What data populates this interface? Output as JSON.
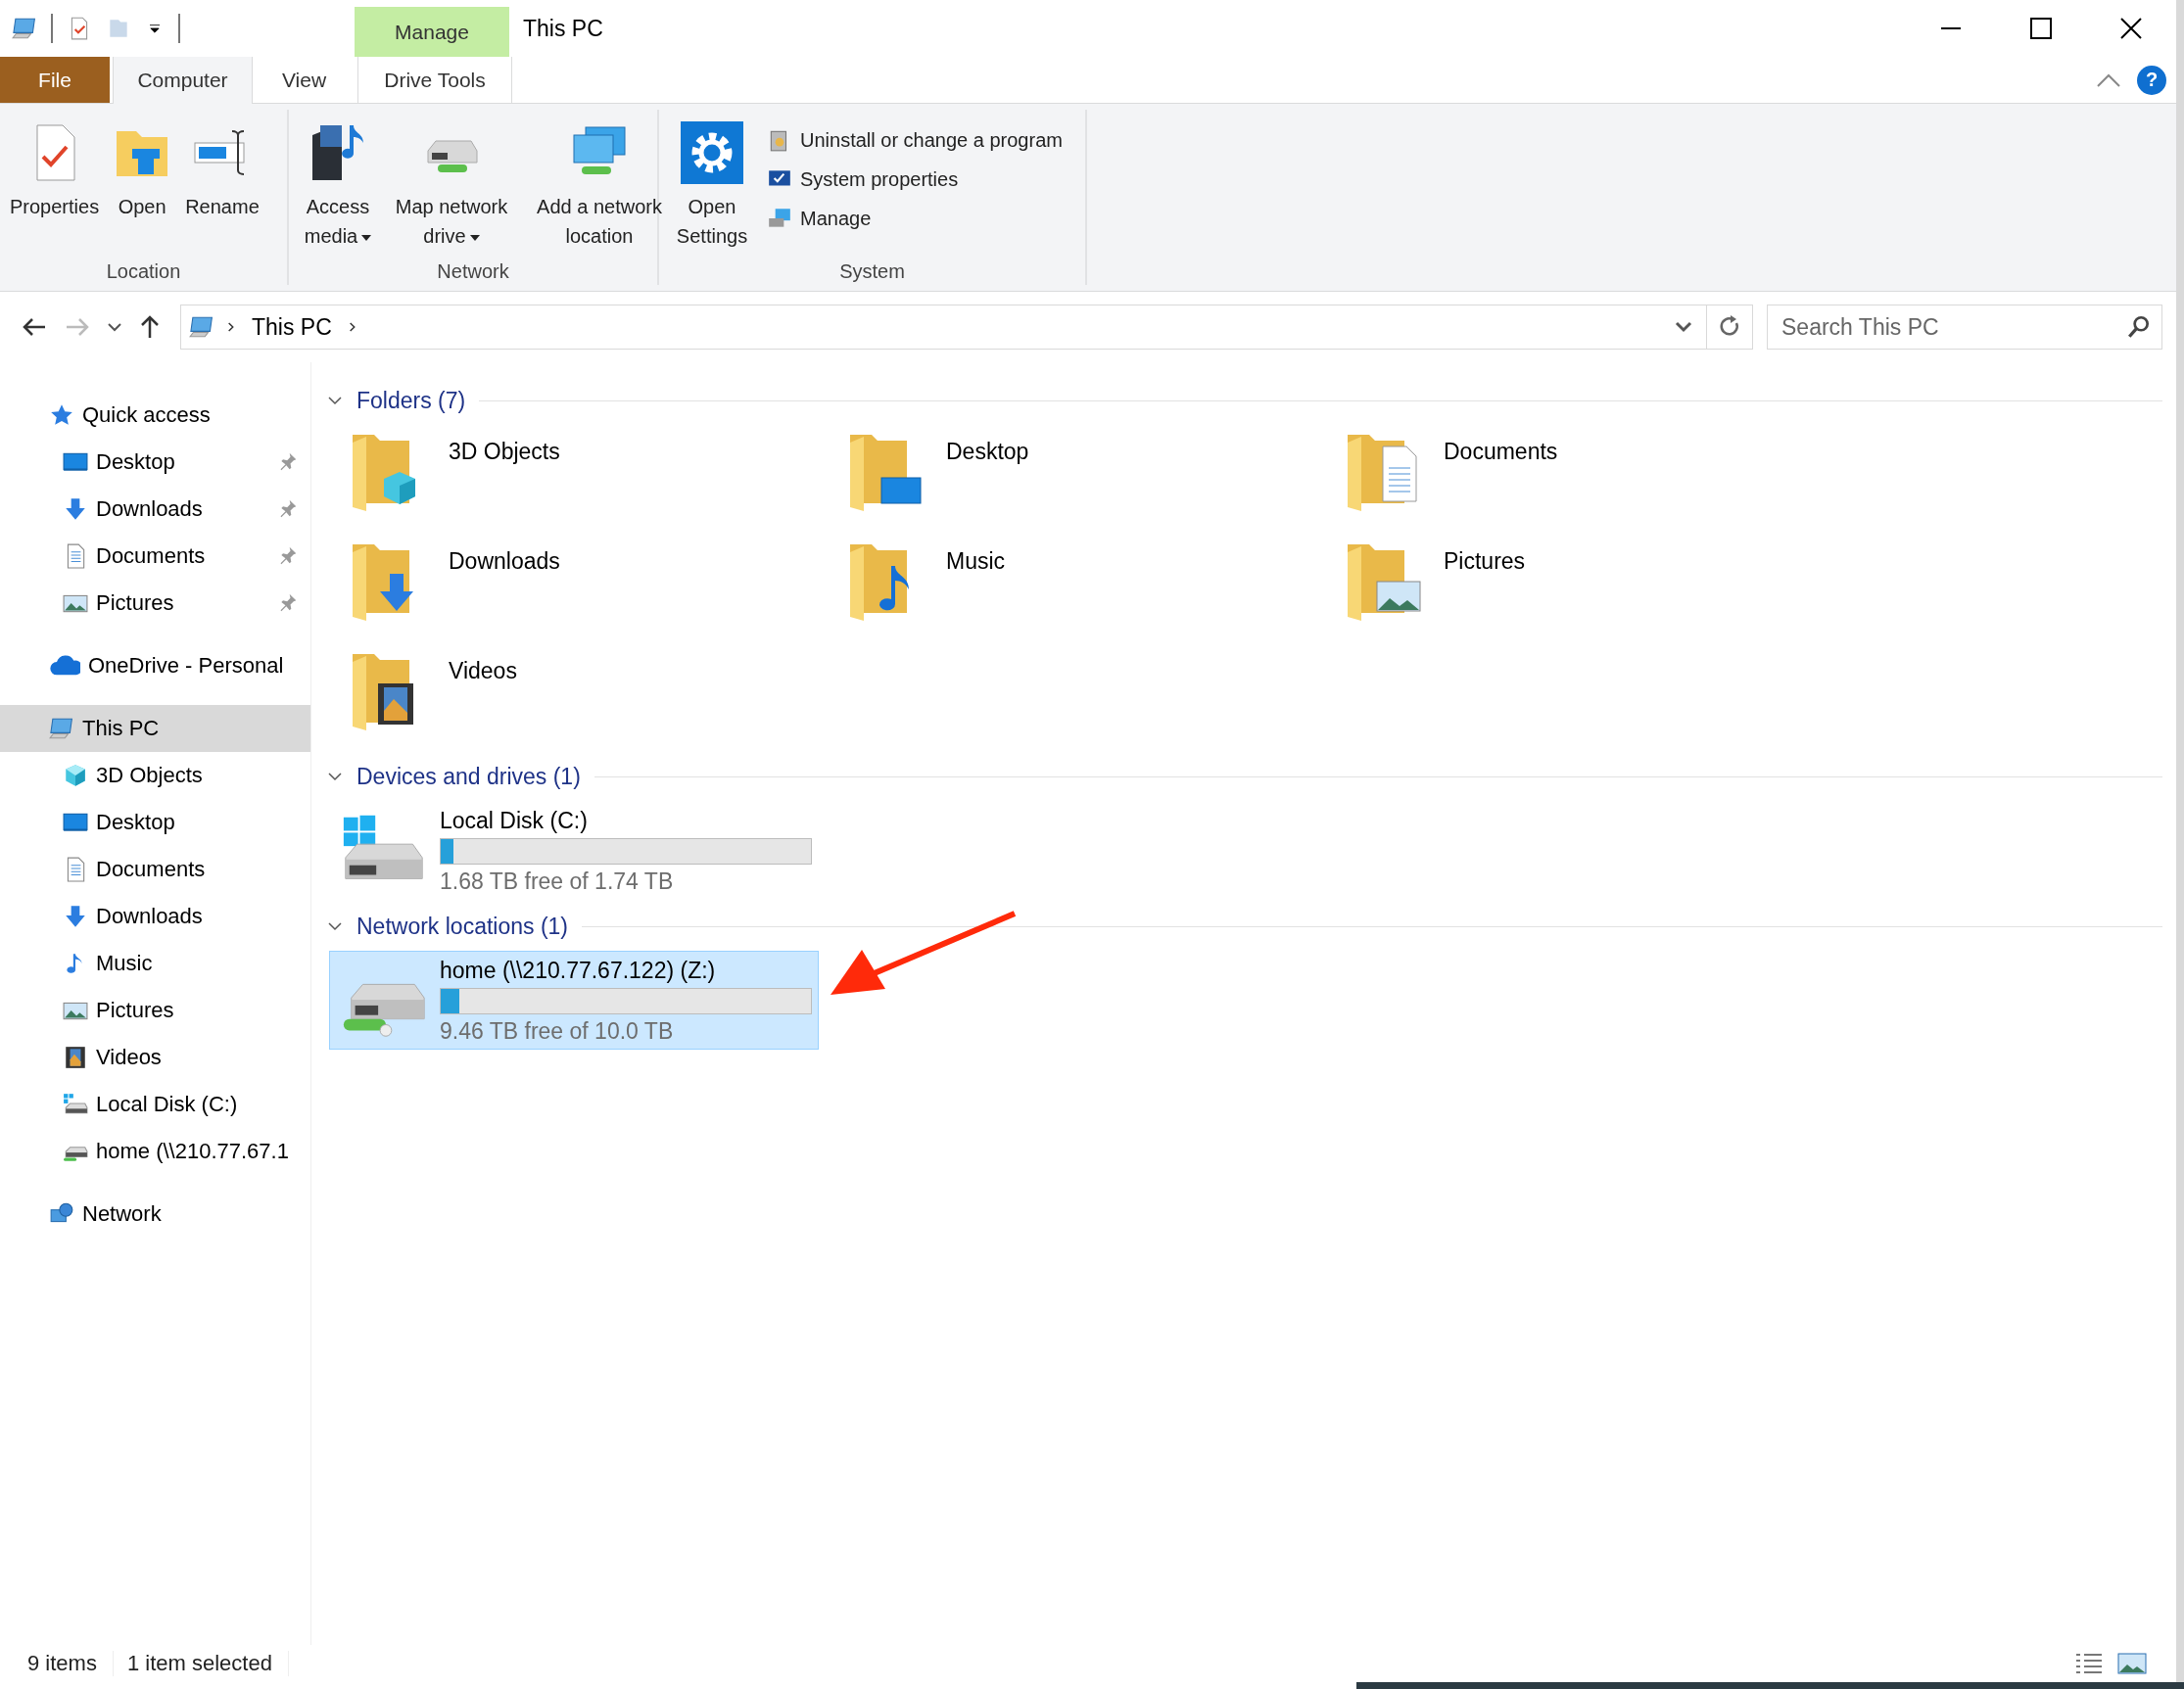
{
  "window": {
    "title": "This PC",
    "context_tab": "Manage",
    "help": "?"
  },
  "ribbon_tabs": [
    {
      "label": "File",
      "kind": "file",
      "selected": false
    },
    {
      "label": "Computer",
      "kind": "plain",
      "selected": true
    },
    {
      "label": "View",
      "kind": "plain",
      "selected": false
    },
    {
      "label": "Drive Tools",
      "kind": "contextual",
      "selected": false
    }
  ],
  "ribbon_groups": [
    {
      "label": "Location",
      "commands": [
        {
          "label": "Properties",
          "kind": "properties",
          "dropdown": false
        },
        {
          "label": "Open",
          "kind": "open",
          "dropdown": false
        },
        {
          "label": "Rename",
          "kind": "rename",
          "dropdown": false
        }
      ]
    },
    {
      "label": "Network",
      "commands": [
        {
          "label": "Access media",
          "kind": "media",
          "dropdown": true
        },
        {
          "label": "Map network drive",
          "kind": "mapdrive",
          "dropdown": true
        },
        {
          "label": "Add a network location",
          "kind": "addlocation",
          "dropdown": false
        }
      ]
    },
    {
      "label": "System",
      "commands": [
        {
          "label": "Open Settings",
          "kind": "settings",
          "dropdown": false
        }
      ],
      "small_commands": [
        {
          "label": "Uninstall or change a program",
          "kind": "uninstall"
        },
        {
          "label": "System properties",
          "kind": "sysprops"
        },
        {
          "label": "Manage",
          "kind": "manage"
        }
      ]
    }
  ],
  "address": {
    "path": [
      "This PC"
    ],
    "search_placeholder": "Search This PC"
  },
  "sidebar": {
    "items": [
      {
        "label": "Quick access",
        "kind": "star",
        "selected": false,
        "children": [
          {
            "label": "Desktop",
            "kind": "desktop",
            "selected": false,
            "pinned": true
          },
          {
            "label": "Downloads",
            "kind": "downloads",
            "selected": false,
            "pinned": true
          },
          {
            "label": "Documents",
            "kind": "documents",
            "selected": false,
            "pinned": true
          },
          {
            "label": "Pictures",
            "kind": "pictures",
            "selected": false,
            "pinned": true
          }
        ]
      },
      {
        "label": "OneDrive - Personal",
        "kind": "onedrive",
        "selected": false
      },
      {
        "label": "This PC",
        "kind": "pc",
        "selected": true,
        "children": [
          {
            "label": "3D Objects",
            "kind": "cube",
            "selected": false
          },
          {
            "label": "Desktop",
            "kind": "desktop",
            "selected": false
          },
          {
            "label": "Documents",
            "kind": "documents",
            "selected": false
          },
          {
            "label": "Downloads",
            "kind": "downloads",
            "selected": false
          },
          {
            "label": "Music",
            "kind": "music",
            "selected": false
          },
          {
            "label": "Pictures",
            "kind": "pictures",
            "selected": false
          },
          {
            "label": "Videos",
            "kind": "videos",
            "selected": false
          },
          {
            "label": "Local Disk (C:)",
            "kind": "disk",
            "selected": false
          },
          {
            "label": "home (\\\\210.77.67.1",
            "kind": "netdrive",
            "selected": false
          }
        ]
      },
      {
        "label": "Network",
        "kind": "network",
        "selected": false
      }
    ]
  },
  "sections": [
    {
      "title": "Folders (7)",
      "kind": "folders",
      "expanded": true,
      "items": [
        {
          "name": "3D Objects",
          "kind": "cube",
          "selected": false
        },
        {
          "name": "Desktop",
          "kind": "desktop",
          "selected": false
        },
        {
          "name": "Documents",
          "kind": "documents",
          "selected": false
        },
        {
          "name": "Downloads",
          "kind": "downloads",
          "selected": false
        },
        {
          "name": "Music",
          "kind": "music",
          "selected": false
        },
        {
          "name": "Pictures",
          "kind": "pictures",
          "selected": false
        },
        {
          "name": "Videos",
          "kind": "videos",
          "selected": false
        }
      ]
    },
    {
      "title": "Devices and drives (1)",
      "kind": "drives",
      "expanded": true,
      "items": [
        {
          "name": "Local Disk (C:)",
          "kind": "disk",
          "free": "1.68 TB free of 1.74 TB",
          "level": 0.035,
          "selected": false
        }
      ]
    },
    {
      "title": "Network locations (1)",
      "kind": "drives",
      "expanded": true,
      "items": [
        {
          "name": "home (\\\\210.77.67.122) (Z:)",
          "kind": "netdrive",
          "free": "9.46 TB free of 10.0 TB",
          "level": 0.05,
          "selected": true
        }
      ]
    }
  ],
  "status_bar": {
    "count": "9 items",
    "selection": "1 item selected"
  }
}
